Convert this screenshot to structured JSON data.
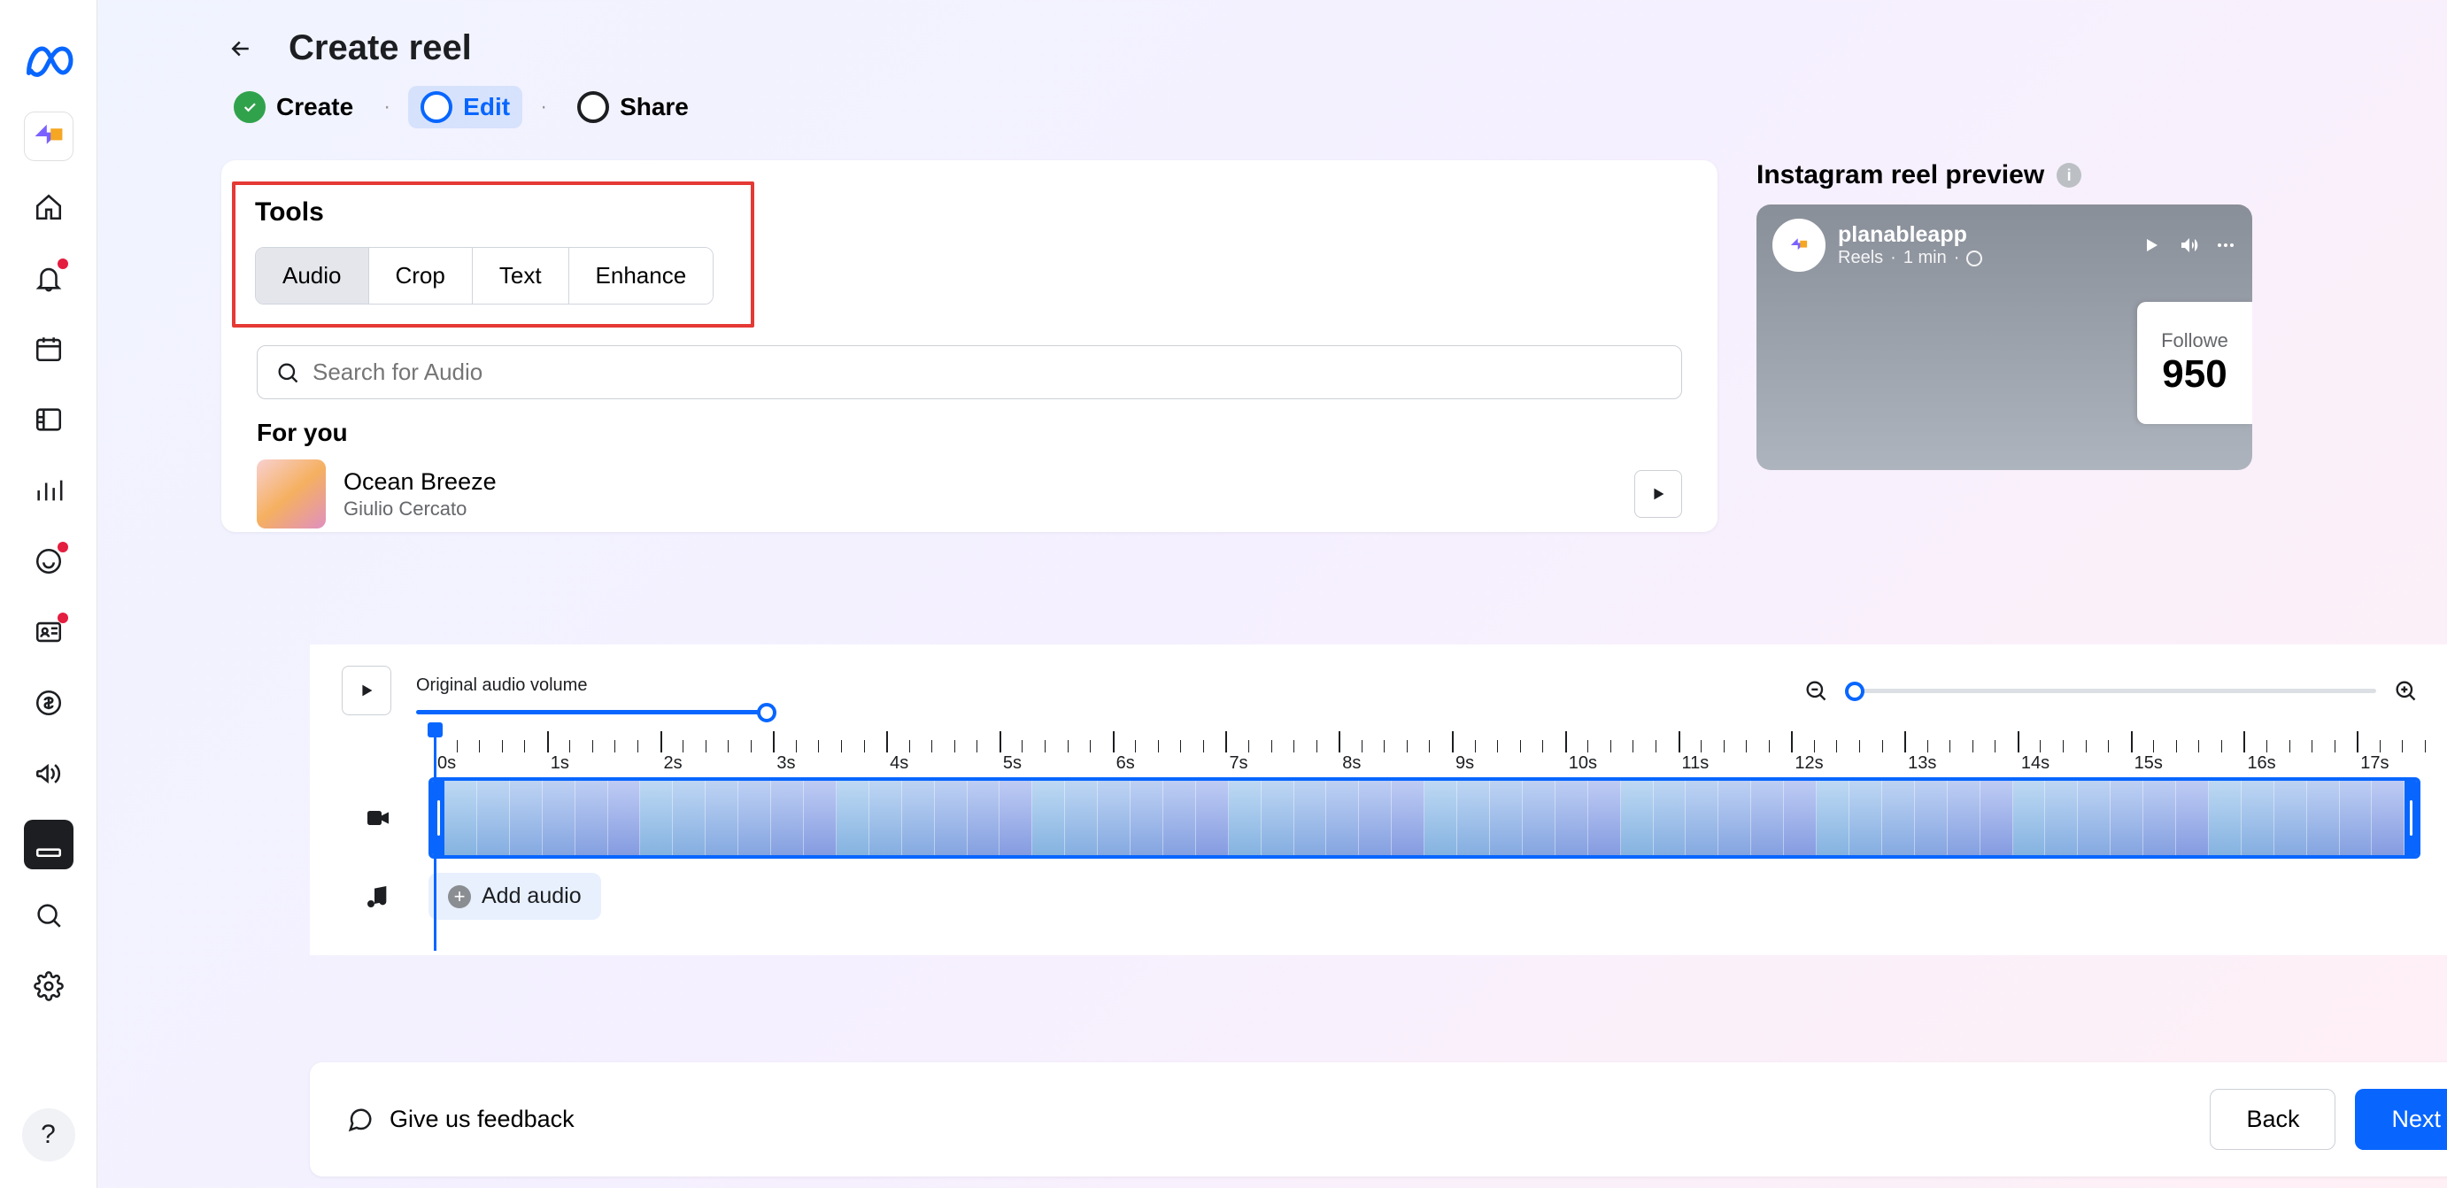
{
  "page": {
    "title": "Create reel"
  },
  "steps": {
    "create": "Create",
    "edit": "Edit",
    "share": "Share"
  },
  "tools": {
    "heading": "Tools",
    "tabs": {
      "audio": "Audio",
      "crop": "Crop",
      "text": "Text",
      "enhance": "Enhance"
    }
  },
  "search": {
    "placeholder": "Search for Audio"
  },
  "audio_section": {
    "heading": "For you",
    "track": {
      "title": "Ocean Breeze",
      "artist": "Giulio Cercato"
    }
  },
  "timeline": {
    "volume_label": "Original audio volume",
    "ticks": [
      "0s",
      "1s",
      "2s",
      "3s",
      "4s",
      "5s",
      "6s",
      "7s",
      "8s",
      "9s",
      "10s",
      "11s",
      "12s",
      "13s",
      "14s",
      "15s",
      "16s",
      "17s"
    ],
    "add_audio_label": "Add audio"
  },
  "preview": {
    "heading": "Instagram reel preview",
    "account_name": "planableapp",
    "account_sub_prefix": "Reels",
    "account_duration": "1 min",
    "followers_label": "Followe",
    "followers_count": "950"
  },
  "footer": {
    "feedback": "Give us feedback",
    "back": "Back",
    "next": "Next"
  }
}
